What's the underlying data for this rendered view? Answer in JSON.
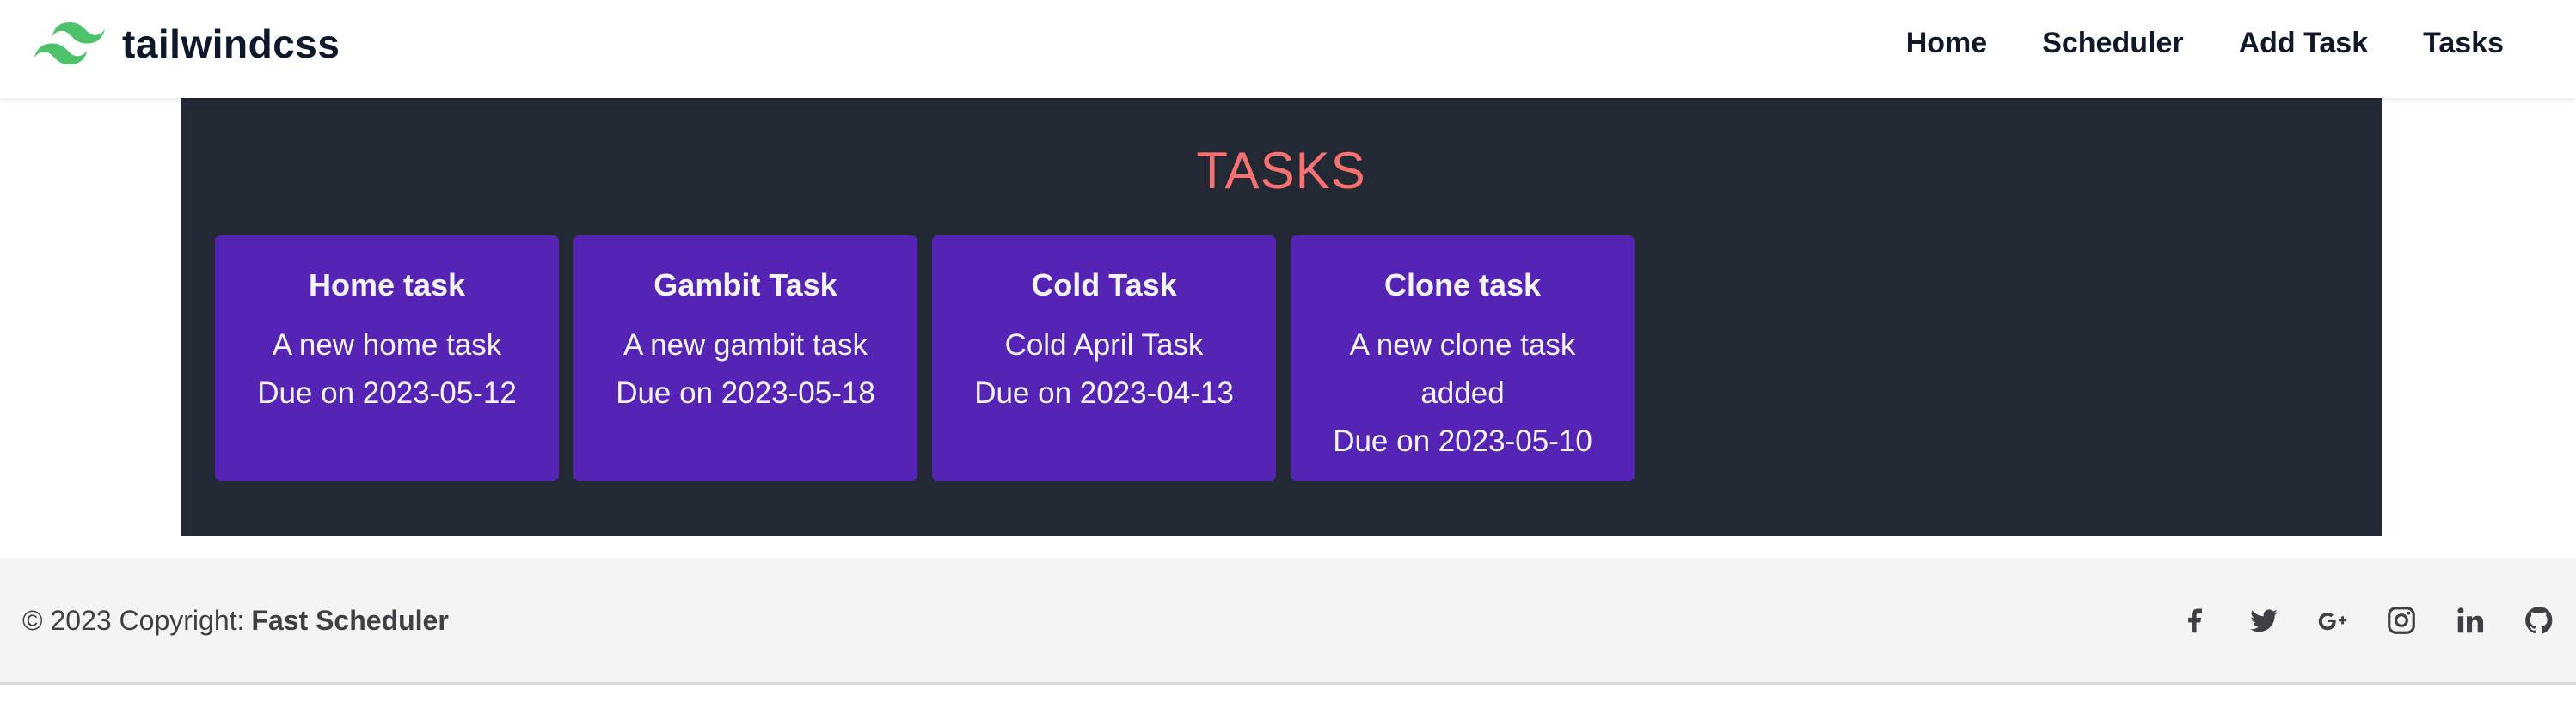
{
  "header": {
    "brand": "tailwindcss",
    "nav": [
      "Home",
      "Scheduler",
      "Add Task",
      "Tasks"
    ]
  },
  "main": {
    "title": "TASKS",
    "tasks": [
      {
        "title": "Home task",
        "description": "A new home task",
        "due": "Due on 2023-05-12"
      },
      {
        "title": "Gambit Task",
        "description": "A new gambit task",
        "due": "Due on 2023-05-18"
      },
      {
        "title": "Cold Task",
        "description": "Cold April Task",
        "due": "Due on 2023-04-13"
      },
      {
        "title": "Clone task",
        "description": "A new clone task added",
        "due": "Due on 2023-05-10"
      }
    ]
  },
  "footer": {
    "copyright_prefix": "© 2023 Copyright:",
    "copyright_name": "Fast Scheduler",
    "social_icons": [
      "facebook-icon",
      "twitter-icon",
      "google-plus-icon",
      "instagram-icon",
      "linkedin-icon",
      "github-icon"
    ]
  },
  "colors": {
    "panel_bg": "#222935",
    "card_bg": "#5624b4",
    "title_accent": "#f87171",
    "logo_green": "#4ec26b",
    "footer_bg": "#f4f4f4"
  }
}
